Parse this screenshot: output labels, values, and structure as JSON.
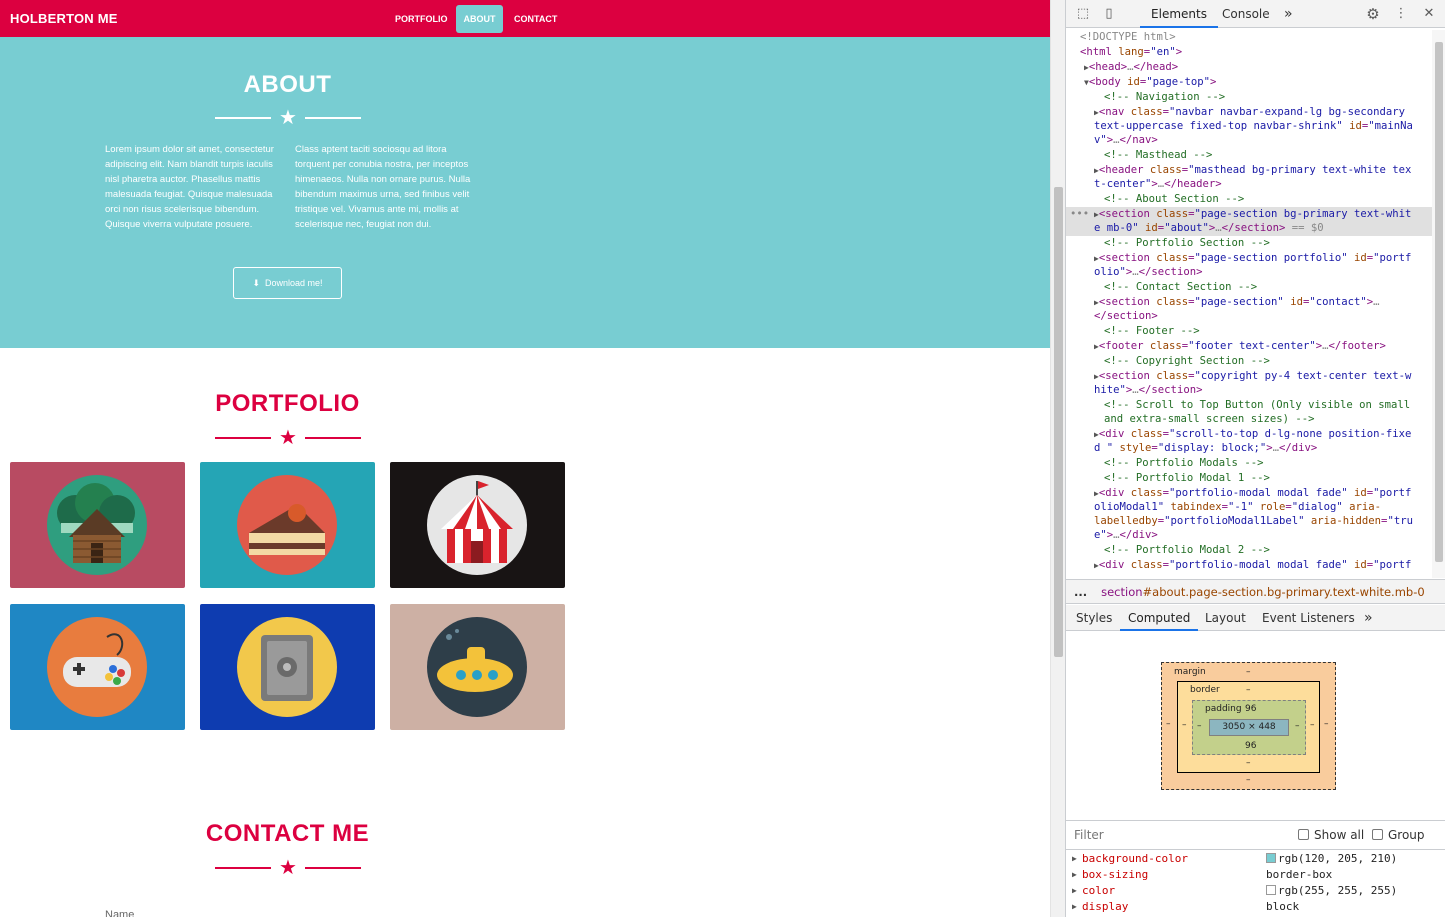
{
  "navbar": {
    "brand": "HOLBERTON ME",
    "links": [
      "PORTFOLIO",
      "ABOUT",
      "CONTACT"
    ],
    "active": "ABOUT",
    "colors": {
      "primary": "#dc0040",
      "active_bg": "#78cdd2"
    }
  },
  "about": {
    "title": "ABOUT",
    "col1": "Lorem ipsum dolor sit amet, consectetur adipiscing elit. Nam blandit turpis iaculis nisl pharetra auctor. Phasellus mattis malesuada feugiat. Quisque malesuada orci non risus scelerisque bibendum. Quisque viverra vulputate posuere.",
    "col2": "Class aptent taciti sociosqu ad litora torquent per conubia nostra, per inceptos himenaeos. Nulla non ornare purus. Nulla bibendum maximus urna, sed finibus velit tristique vel. Vivamus ante mi, mollis at scelerisque nec, feugiat non dui.",
    "download_label": "Download me!",
    "background": "#78cdd2"
  },
  "portfolio": {
    "title": "PORTFOLIO",
    "items": [
      {
        "icon": "cabin-icon",
        "bg": "#b84b62"
      },
      {
        "icon": "cake-icon",
        "bg": "#25a5b5"
      },
      {
        "icon": "circus-tent-icon",
        "bg": "#181414"
      },
      {
        "icon": "game-controller-icon",
        "bg": "#1f87c4"
      },
      {
        "icon": "safe-icon",
        "bg": "#0e3cb0"
      },
      {
        "icon": "submarine-icon",
        "bg": "#cdb0a4"
      }
    ]
  },
  "contact": {
    "title": "CONTACT ME",
    "name_label": "Name"
  },
  "devtools": {
    "tabs": [
      "Elements",
      "Console"
    ],
    "more": "»",
    "breadcrumb_tag": "section",
    "breadcrumb_rest": "#about.page-section.bg-primary.text-white.mb-0",
    "ellipsis": "...",
    "subtabs": [
      "Styles",
      "Computed",
      "Layout",
      "Event Listeners"
    ],
    "box": {
      "margin_label": "margin",
      "border_label": "border",
      "padding_label": "padding",
      "padding_top": "96",
      "padding_bottom": "96",
      "content": "3050 × 448",
      "dash": "–"
    },
    "filter_placeholder": "Filter",
    "show_all": "Show all",
    "group": "Group",
    "properties": [
      {
        "name": "background-color",
        "value": "rgb(120, 205, 210)",
        "swatch": "#78cdd2"
      },
      {
        "name": "box-sizing",
        "value": "border-box"
      },
      {
        "name": "color",
        "value": "rgb(255, 255, 255)",
        "swatch": "#ffffff"
      },
      {
        "name": "display",
        "value": "block"
      }
    ]
  }
}
